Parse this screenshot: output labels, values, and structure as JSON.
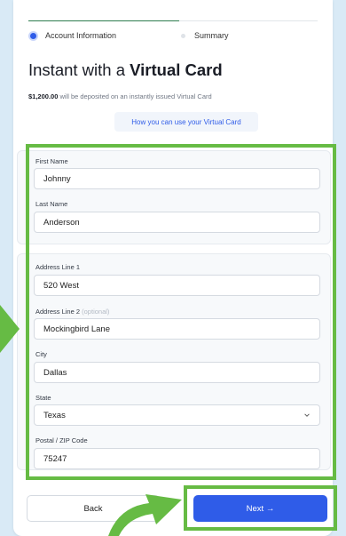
{
  "steps": [
    {
      "label": "Account Information",
      "active": true
    },
    {
      "label": "Summary",
      "active": false
    }
  ],
  "header": {
    "title_prefix": "Instant with a ",
    "title_bold": "Virtual Card",
    "subtitle_amount": "$1,200.00",
    "subtitle_rest": " will be deposited on an instantly issued Virtual Card",
    "info_link": "How you can use your Virtual Card"
  },
  "form": {
    "first_name": {
      "label": "First Name",
      "value": "Johnny"
    },
    "last_name": {
      "label": "Last Name",
      "value": "Anderson"
    },
    "address1": {
      "label": "Address Line 1",
      "value": "520 West"
    },
    "address2": {
      "label": "Address Line 2",
      "optional": "(optional)",
      "value": "Mockingbird Lane"
    },
    "city": {
      "label": "City",
      "value": "Dallas"
    },
    "state": {
      "label": "State",
      "value": "Texas"
    },
    "zip": {
      "label": "Postal / ZIP Code",
      "value": "75247"
    }
  },
  "buttons": {
    "back": "Back",
    "next": "Next →"
  },
  "colors": {
    "accent": "#2f5ce8",
    "highlight": "#66bb44",
    "background": "#d9eaf6"
  }
}
